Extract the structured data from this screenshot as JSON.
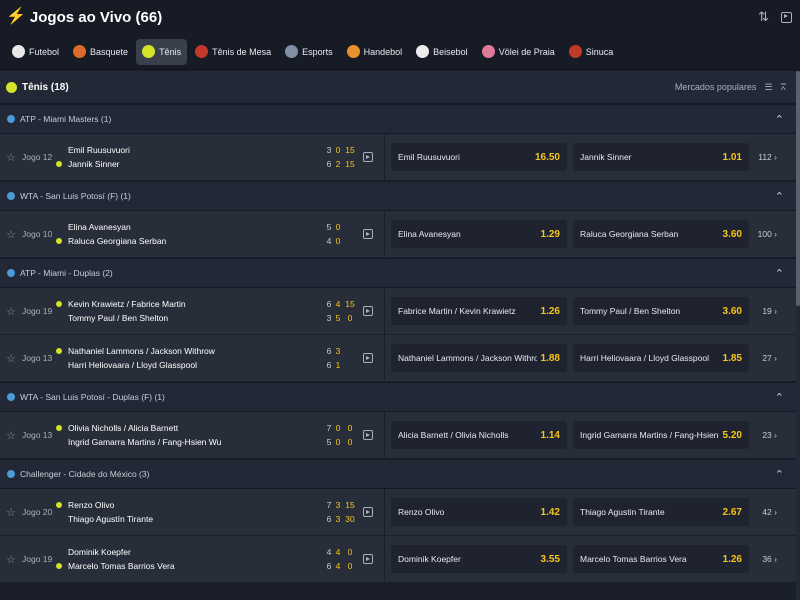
{
  "header": {
    "title": "Jogos ao Vivo (66)"
  },
  "sports": [
    {
      "label": "Futebol",
      "color": "#e8e8e8"
    },
    {
      "label": "Basquete",
      "color": "#e06a2c"
    },
    {
      "label": "Tênis",
      "color": "#d4e22a",
      "active": true
    },
    {
      "label": "Tênis de Mesa",
      "color": "#c0392b"
    },
    {
      "label": "Esports",
      "color": "#7f8fa6"
    },
    {
      "label": "Handebol",
      "color": "#e8902c"
    },
    {
      "label": "Beisebol",
      "color": "#ececec"
    },
    {
      "label": "Vôlei de Praia",
      "color": "#e07a9a"
    },
    {
      "label": "Sinuca",
      "color": "#c0392b"
    }
  ],
  "section": {
    "title": "Tênis (18)",
    "markets_label": "Mercados populares"
  },
  "leagues": [
    {
      "name": "ATP - Miami Masters (1)",
      "matches": [
        {
          "jogo": "Jogo 12",
          "home": "Emil Ruusuvuori",
          "away": "Jannik Sinner",
          "serving": "away",
          "home_score": [
            "3",
            "0",
            "15"
          ],
          "away_score": [
            "6",
            "2",
            "15"
          ],
          "odds_home": "Emil Ruusuvuori",
          "odds_home_val": "16.50",
          "odds_away": "Jannik Sinner",
          "odds_away_val": "1.01",
          "more": "112"
        }
      ]
    },
    {
      "name": "WTA - San Luis Potosí (F) (1)",
      "matches": [
        {
          "jogo": "Jogo 10",
          "home": "Elina Avanesyan",
          "away": "Raluca Georgiana Serban",
          "serving": "away",
          "home_score": [
            "5",
            "0",
            ""
          ],
          "away_score": [
            "4",
            "0",
            ""
          ],
          "odds_home": "Elina Avanesyan",
          "odds_home_val": "1.29",
          "odds_away": "Raluca Georgiana Serban",
          "odds_away_val": "3.60",
          "more": "100"
        }
      ]
    },
    {
      "name": "ATP - Miami - Duplas (2)",
      "matches": [
        {
          "jogo": "Jogo 19",
          "home": "Kevin Krawietz / Fabrice Martin",
          "away": "Tommy Paul / Ben Shelton",
          "serving": "home",
          "home_score": [
            "6",
            "4",
            "15"
          ],
          "away_score": [
            "3",
            "5",
            "0"
          ],
          "odds_home": "Fabrice Martin / Kevin Krawietz",
          "odds_home_val": "1.26",
          "odds_away": "Tommy Paul / Ben Shelton",
          "odds_away_val": "3.60",
          "more": "19"
        },
        {
          "jogo": "Jogo 13",
          "home": "Nathaniel Lammons / Jackson Withrow",
          "away": "Harri Heliovaara / Lloyd Glasspool",
          "serving": "home",
          "home_score": [
            "6",
            "3",
            ""
          ],
          "away_score": [
            "6",
            "1",
            ""
          ],
          "odds_home": "Nathaniel Lammons / Jackson Withrow",
          "odds_home_val": "1.88",
          "odds_away": "Harri Heliovaara / Lloyd Glasspool",
          "odds_away_val": "1.85",
          "more": "27"
        }
      ]
    },
    {
      "name": "WTA - San Luis Potosí - Duplas (F) (1)",
      "matches": [
        {
          "jogo": "Jogo 13",
          "home": "Olivia Nicholls / Alicia Barnett",
          "away": "Ingrid Gamarra Martins / Fang-Hsien Wu",
          "serving": "home",
          "home_score": [
            "7",
            "0",
            "0"
          ],
          "away_score": [
            "5",
            "0",
            "0"
          ],
          "odds_home": "Alicia Barnett / Olivia Nicholls",
          "odds_home_val": "1.14",
          "odds_away": "Ingrid Gamarra Martins / Fang-Hsien Wu",
          "odds_away_val": "5.20",
          "more": "23"
        }
      ]
    },
    {
      "name": "Challenger - Cidade do México (3)",
      "matches": [
        {
          "jogo": "Jogo 20",
          "home": "Renzo Olivo",
          "away": "Thiago Agustín Tirante",
          "serving": "home",
          "home_score": [
            "7",
            "3",
            "15"
          ],
          "away_score": [
            "6",
            "3",
            "30"
          ],
          "odds_home": "Renzo Olivo",
          "odds_home_val": "1.42",
          "odds_away": "Thiago Agustin Tirante",
          "odds_away_val": "2.67",
          "more": "42"
        },
        {
          "jogo": "Jogo 19",
          "home": "Dominik Koepfer",
          "away": "Marcelo Tomas Barrios Vera",
          "serving": "away",
          "home_score": [
            "4",
            "4",
            "0"
          ],
          "away_score": [
            "6",
            "4",
            "0"
          ],
          "odds_home": "Dominik Koepfer",
          "odds_home_val": "3.55",
          "odds_away": "Marcelo Tomas Barrios Vera",
          "odds_away_val": "1.26",
          "more": "36"
        }
      ]
    }
  ]
}
